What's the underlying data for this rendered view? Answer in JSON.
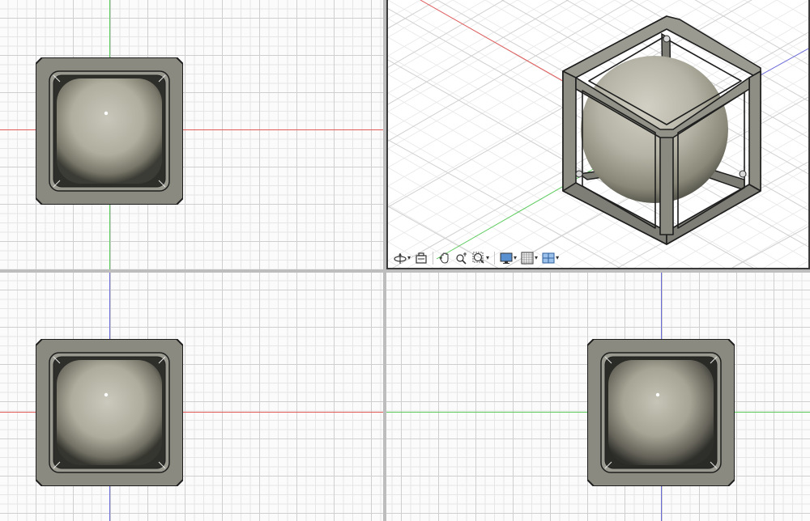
{
  "app": {
    "layout": "four-viewports",
    "axis_colors": {
      "x": "#e05a5a",
      "y": "#5aca5a",
      "z": "#6a6ad8"
    },
    "grid_colors": {
      "major": "#cfcfcf",
      "minor": "#e6e6e6",
      "background": "#fbfbfb"
    },
    "model_colors": {
      "frame": "#8a8a80",
      "frame_dark": "#6e6e66",
      "frame_edge": "#1e1e1e",
      "sphere": "#b4b2a4"
    }
  },
  "viewports": {
    "top_left": {
      "view": "front",
      "axes": [
        "x",
        "y"
      ]
    },
    "top_right": {
      "view": "isometric",
      "axes": [
        "x",
        "y",
        "z"
      ],
      "active": true
    },
    "bottom_left": {
      "view": "top",
      "axes": [
        "x",
        "z"
      ]
    },
    "bottom_right": {
      "view": "right",
      "axes": [
        "y",
        "z"
      ]
    }
  },
  "nav_toolbar": {
    "items": [
      {
        "icon": "orbit-icon",
        "has_menu": true
      },
      {
        "icon": "look-at-icon",
        "has_menu": false
      },
      {
        "icon": "pan-hand-icon",
        "has_menu": false
      },
      {
        "icon": "zoom-icon",
        "has_menu": false
      },
      {
        "icon": "fit-zoom-icon",
        "has_menu": true
      },
      {
        "icon": "display-settings-icon",
        "has_menu": true
      },
      {
        "icon": "grid-snap-icon",
        "has_menu": true
      },
      {
        "icon": "viewports-layout-icon",
        "has_menu": true
      }
    ]
  }
}
